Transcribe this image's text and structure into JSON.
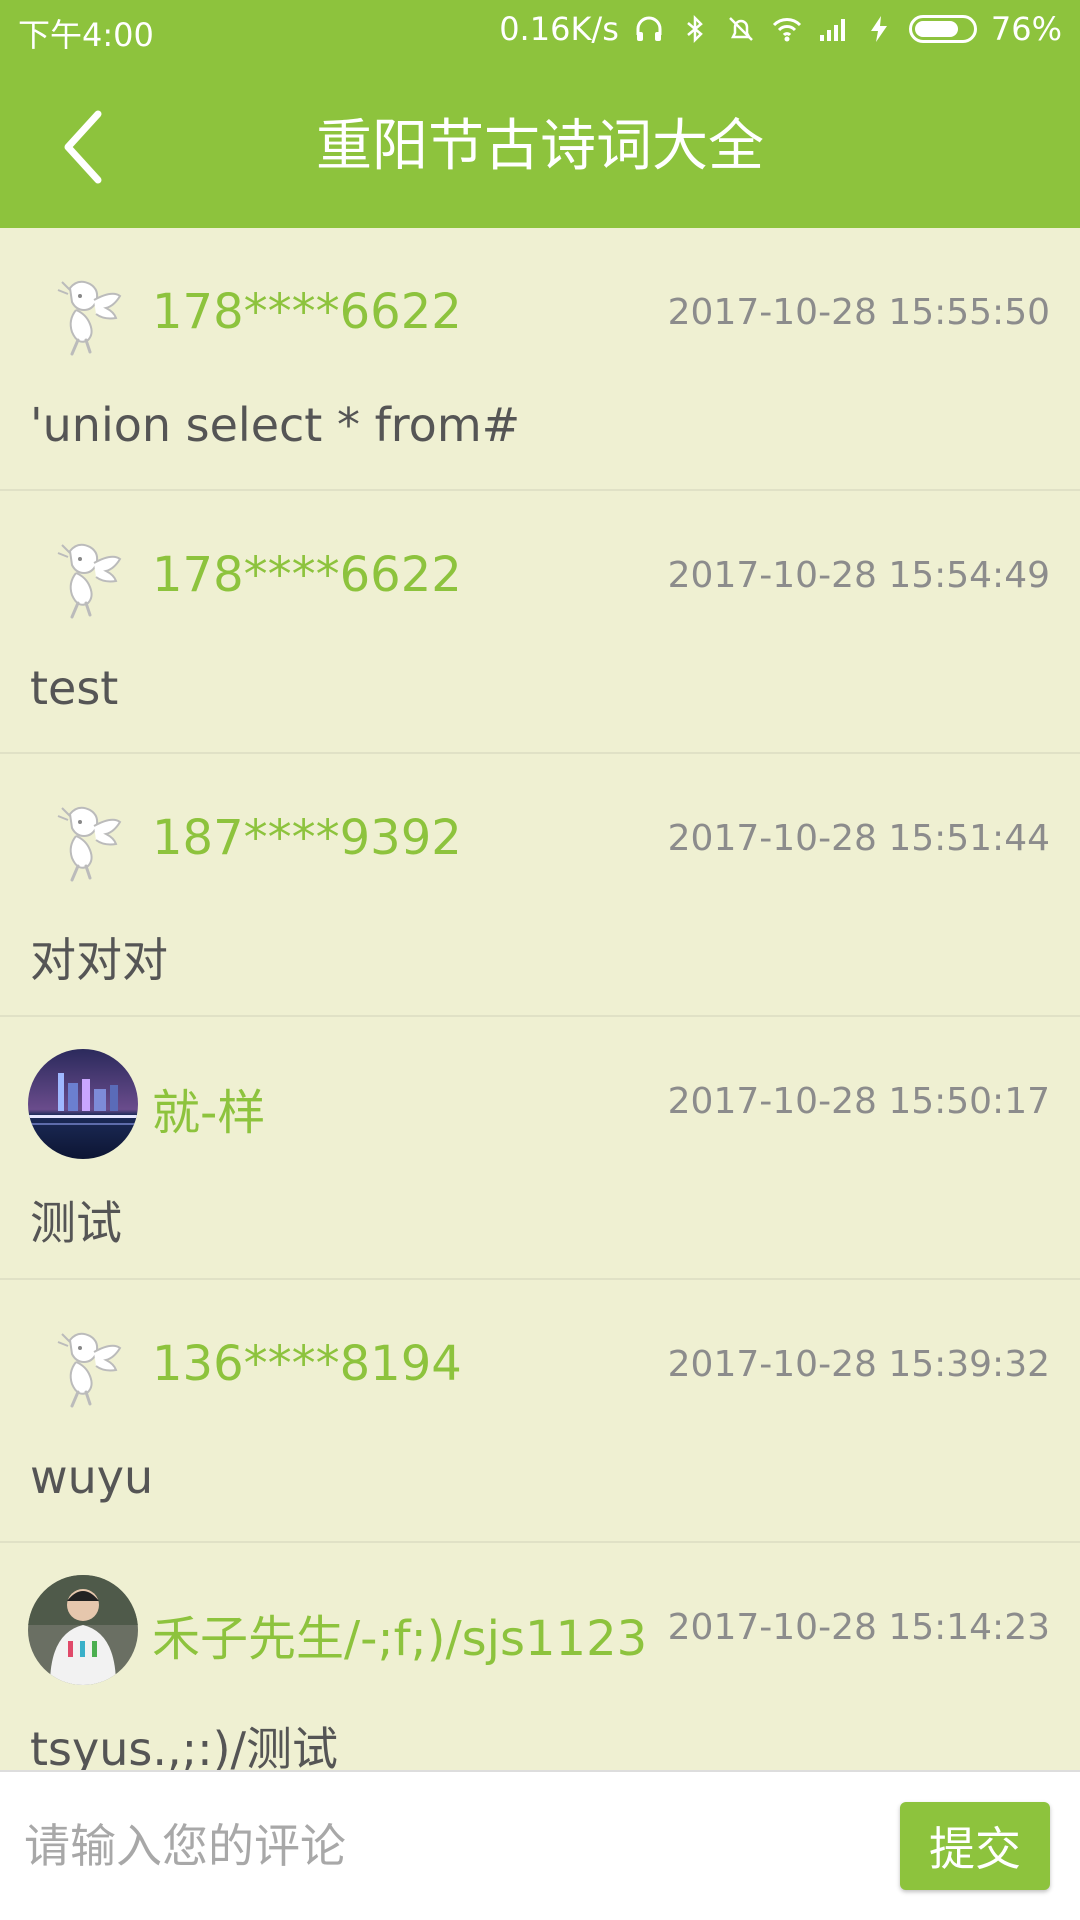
{
  "status_bar": {
    "time": "下午4:00",
    "network_speed": "0.16K/s",
    "battery_percent": "76%",
    "battery_level": 0.76,
    "icons": [
      "headset-icon",
      "bluetooth-icon",
      "mute-icon",
      "wifi-icon",
      "signal-icon",
      "charging-icon",
      "battery-icon"
    ]
  },
  "header": {
    "title": "重阳节古诗词大全",
    "back_icon": "back-arrow-icon"
  },
  "comments": [
    {
      "user": "178****6622",
      "time": "2017-10-28 15:55:50",
      "text": "'union select * from#",
      "avatar": "default-dragon"
    },
    {
      "user": "178****6622",
      "time": "2017-10-28 15:54:49",
      "text": "test",
      "avatar": "default-dragon"
    },
    {
      "user": "187****9392",
      "time": "2017-10-28 15:51:44",
      "text": "对对对",
      "avatar": "default-dragon"
    },
    {
      "user": "就-样",
      "time": "2017-10-28 15:50:17",
      "text": "测试",
      "avatar": "city-night-photo"
    },
    {
      "user": "136****8194",
      "time": "2017-10-28 15:39:32",
      "text": "wuyu",
      "avatar": "default-dragon"
    },
    {
      "user": "禾子先生/-;f;)/sjs1123",
      "time": "2017-10-28 15:14:23",
      "text": "tsyus.,;:)/测试",
      "avatar": "person-photo"
    }
  ],
  "composer": {
    "placeholder": "请输入您的评论",
    "value": "",
    "submit_label": "提交"
  },
  "colors": {
    "accent": "#8dc33d",
    "list_background": "#eff0d2",
    "timestamp": "#8c8c8c",
    "content_text": "#555555"
  }
}
